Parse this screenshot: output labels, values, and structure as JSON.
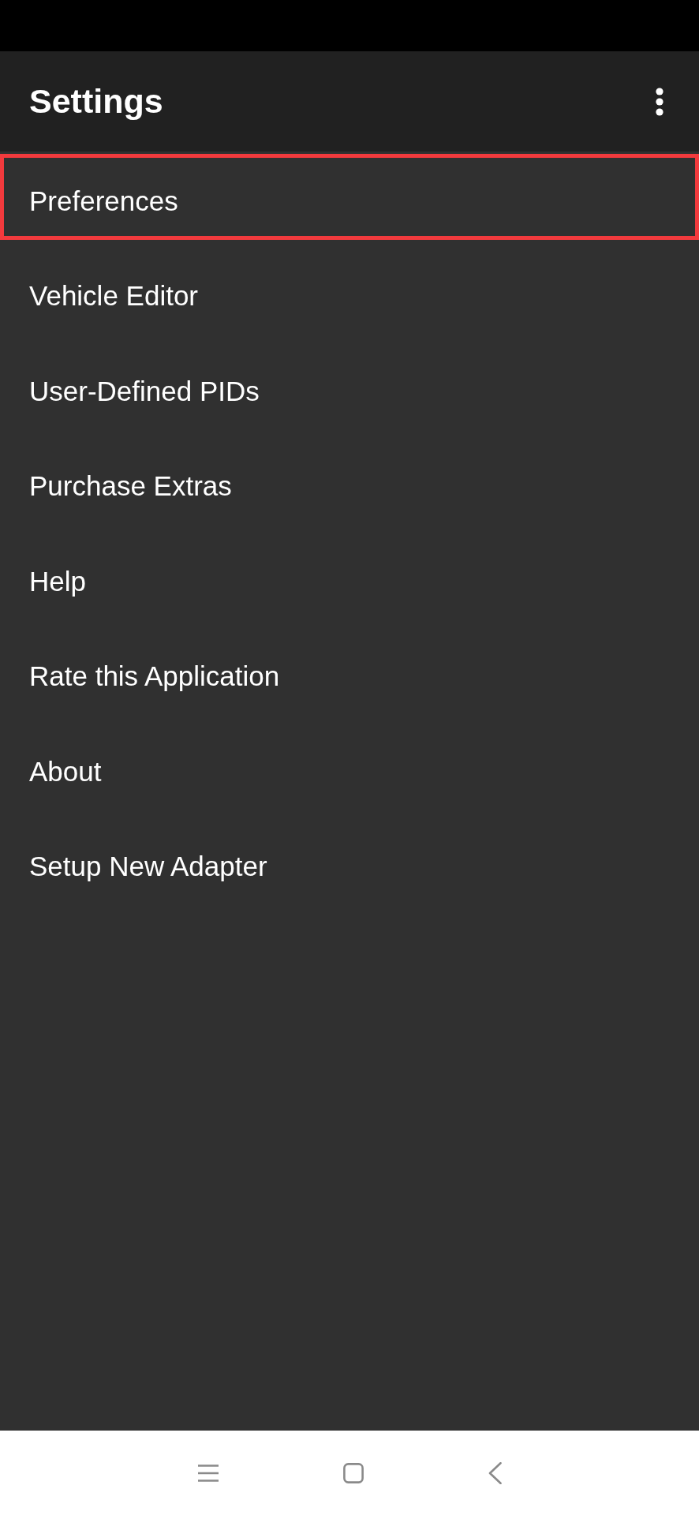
{
  "app_bar": {
    "title": "Settings"
  },
  "items": [
    {
      "label": "Preferences",
      "selected": true
    },
    {
      "label": "Vehicle Editor",
      "selected": false
    },
    {
      "label": "User-Defined PIDs",
      "selected": false
    },
    {
      "label": "Purchase Extras",
      "selected": false
    },
    {
      "label": "Help",
      "selected": false
    },
    {
      "label": "Rate this Application",
      "selected": false
    },
    {
      "label": "About",
      "selected": false
    },
    {
      "label": "Setup New Adapter",
      "selected": false
    }
  ]
}
